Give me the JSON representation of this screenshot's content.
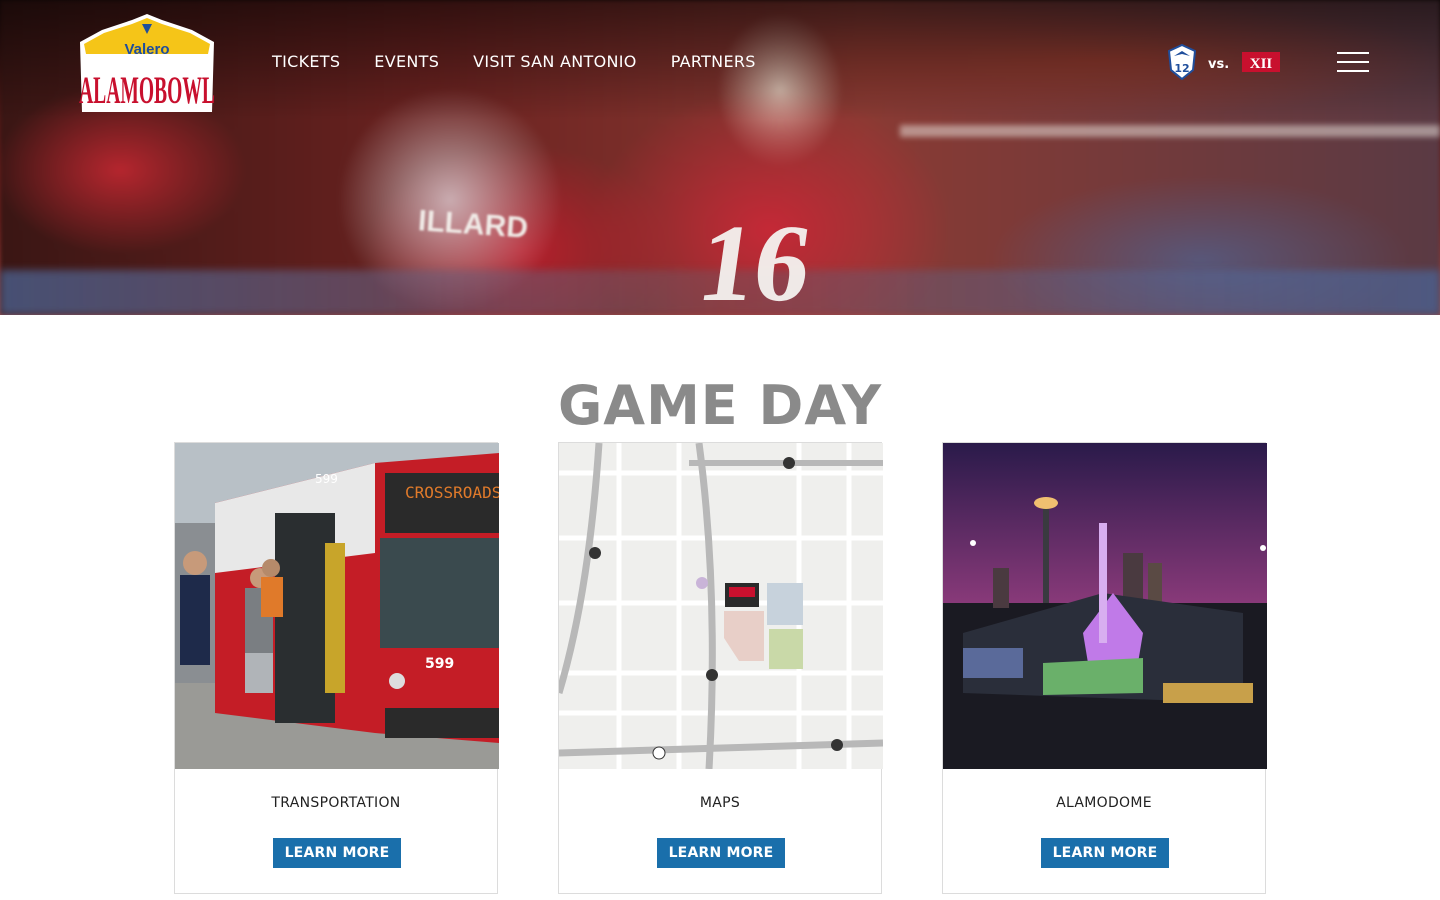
{
  "brand": {
    "logo_top": "Valero",
    "logo_main": "ALAMOBOWL"
  },
  "nav": {
    "items": [
      {
        "label": "TICKETS"
      },
      {
        "label": "EVENTS"
      },
      {
        "label": "VISIT SAN ANTONIO"
      },
      {
        "label": "PARTNERS"
      }
    ]
  },
  "matchup": {
    "team1": "PAC-12",
    "vs": "vs.",
    "team2": "XII"
  },
  "hero": {
    "jersey_number": "16",
    "jersey_name": "ILLARD"
  },
  "section": {
    "title": "GAME DAY"
  },
  "cards": [
    {
      "title": "TRANSPORTATION",
      "button": "LEARN MORE",
      "image": "bus-photo"
    },
    {
      "title": "MAPS",
      "button": "LEARN MORE",
      "image": "map-image"
    },
    {
      "title": "ALAMODOME",
      "button": "LEARN MORE",
      "image": "alamodome-photo"
    }
  ],
  "colors": {
    "button_blue": "#1a6fab",
    "title_gray": "#8a8a8a",
    "logo_red": "#c8102e",
    "logo_yellow": "#f5c518"
  }
}
